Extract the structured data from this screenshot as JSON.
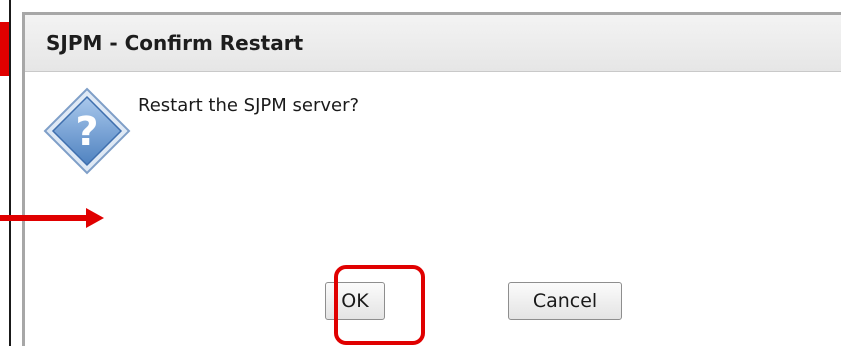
{
  "dialog": {
    "title": "SJPM - Confirm Restart",
    "message": "Restart the SJPM server?",
    "icon": "question-icon"
  },
  "buttons": {
    "ok_label": "OK",
    "cancel_label": "Cancel"
  },
  "annotations": {
    "highlight_color": "#e00000",
    "highlight_target": "ok-button",
    "arrow_color": "#e00000"
  },
  "colors": {
    "title_bar": "#e9e9e9",
    "icon_blue": "#6b9bd1",
    "border": "#a7a7a7"
  }
}
